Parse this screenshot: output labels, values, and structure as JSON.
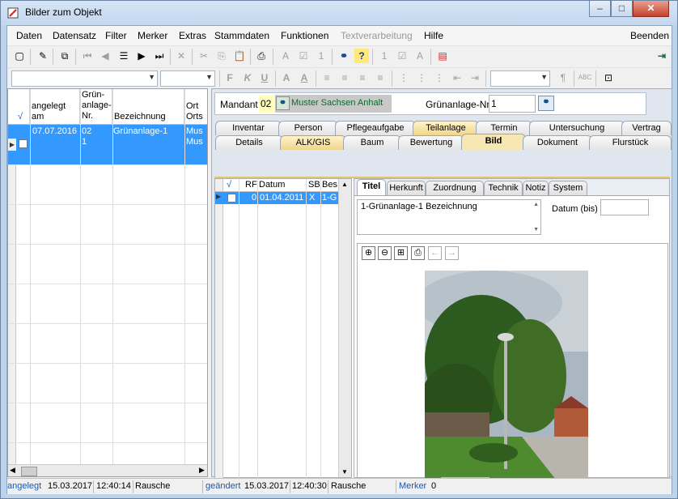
{
  "window": {
    "title": "Bilder zum Objekt",
    "min": "–",
    "max": "□",
    "close": "✕"
  },
  "menu": {
    "items": [
      "Daten",
      "Datensatz",
      "Filter",
      "Merker",
      "Extras",
      "Stammdaten",
      "Funktionen",
      "Textverarbeitung",
      "Hilfe"
    ],
    "disabled_item": "Textverarbeitung",
    "exit": "Beenden"
  },
  "toolbar": {
    "icons": [
      "new-record-icon",
      "edit-icon",
      "copy-record-icon",
      "first-record-icon",
      "prev-record-icon",
      "filter-icon",
      "next-record-icon",
      "last-record-icon",
      "delete-icon",
      "cut-icon",
      "copy-icon",
      "paste-icon",
      "print-icon",
      "font-a-icon",
      "check-icon",
      "number-1-icon",
      "binoculars-icon",
      "help-icon",
      "box-1-icon",
      "box-check-icon",
      "box-a-icon",
      "calendar-icon",
      "exit-door-icon"
    ],
    "format_labels": {
      "bold": "F",
      "italic": "K",
      "underline": "U",
      "font_a": "A",
      "font_color": "A",
      "paragraph": "¶",
      "spell": "ABC"
    }
  },
  "left_grid": {
    "headers": [
      "√",
      "angelegt am",
      "Grün-anlage-Nr.",
      "Bezeichnung",
      "Ort Orts"
    ],
    "row": {
      "angelegt": "07.07.2016",
      "nr_line1": "02",
      "nr_line2": "1",
      "bezeichnung": "Grünanlage-1",
      "ort_line1": "Mus",
      "ort_line2": "Mus"
    }
  },
  "mandant": {
    "label": "Mandant",
    "code": "02",
    "name": "Muster Sachsen Anhalt",
    "gr_label": "Grünanlage-Nr.",
    "gr_value": "1"
  },
  "tabs_row1": [
    "Inventar",
    "Person",
    "Pflegeaufgabe",
    "Teilanlage",
    "Termin",
    "Untersuchung",
    "Vertrag"
  ],
  "tabs_row2": [
    "Details",
    "ALK/GIS",
    "Baum",
    "Bewertung",
    "Bild",
    "Dokument",
    "Flurstück"
  ],
  "selected_tab": "Bild",
  "sub_grid": {
    "headers": [
      "√",
      "RF",
      "Datum",
      "SB",
      "Bes"
    ],
    "row": {
      "rf": "0",
      "datum": "01.04.2011",
      "sb": "X",
      "bes": "1-G"
    }
  },
  "detail_tabs": [
    "Titel",
    "Herkunft",
    "Zuordnung",
    "Technik",
    "Notiz",
    "System"
  ],
  "selected_detail_tab": "Titel",
  "titel_text": "1-Grünanlage-1  Bezeichnung",
  "datum_label": "Datum (bis)",
  "datum_value": "",
  "status": {
    "angelegt_label": "angelegt",
    "angelegt_date": "15.03.2017",
    "angelegt_time": "12:40:14",
    "angelegt_user": "Rausche",
    "geaendert_label": "geändert",
    "geaendert_date": "15.03.2017",
    "geaendert_time": "12:40:30",
    "geaendert_user": "Rausche",
    "merker_label": "Merker",
    "merker_value": "0"
  },
  "colors": {
    "selection": "#3399ff",
    "accent": "#1a58b0",
    "tab_gold": "#f0d68c"
  }
}
